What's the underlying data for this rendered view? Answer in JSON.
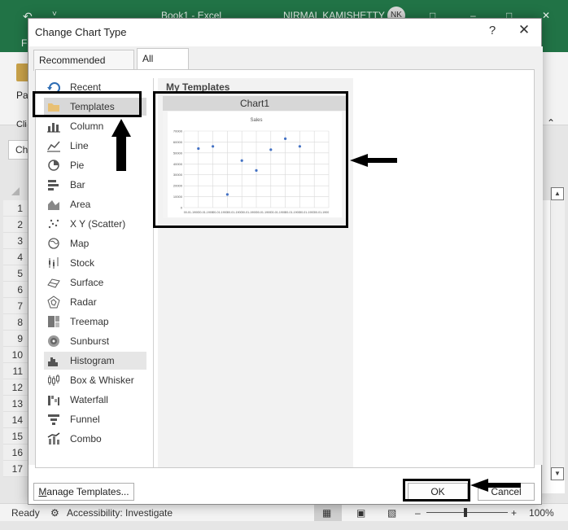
{
  "excel": {
    "title_left": "Book1 - Excel",
    "user_name": "NIRMAL KAMISHETTY",
    "user_initials": "NK",
    "ribbon_letters": [
      "F",
      "Pa",
      "Cli",
      "Ch"
    ],
    "rows": [
      "1",
      "2",
      "3",
      "4",
      "5",
      "6",
      "7",
      "8",
      "9",
      "10",
      "11",
      "12",
      "13",
      "14",
      "15",
      "16",
      "17"
    ],
    "status_ready": "Ready",
    "status_accessibility": "Accessibility: Investigate",
    "zoom_minus": "–",
    "zoom_plus": "+",
    "zoom_level": "100%"
  },
  "dialog": {
    "title": "Change Chart Type",
    "help": "?",
    "close": "✕",
    "tabs": [
      {
        "label": "Recommended Charts"
      },
      {
        "label": "All Charts"
      }
    ],
    "categories": [
      {
        "label": "Recent",
        "icon": "recent-icon"
      },
      {
        "label": "Templates",
        "icon": "folder-icon"
      },
      {
        "label": "Column",
        "icon": "column-chart-icon"
      },
      {
        "label": "Line",
        "icon": "line-chart-icon"
      },
      {
        "label": "Pie",
        "icon": "pie-chart-icon"
      },
      {
        "label": "Bar",
        "icon": "bar-chart-icon"
      },
      {
        "label": "Area",
        "icon": "area-chart-icon"
      },
      {
        "label": "X Y (Scatter)",
        "icon": "scatter-chart-icon"
      },
      {
        "label": "Map",
        "icon": "map-chart-icon"
      },
      {
        "label": "Stock",
        "icon": "stock-chart-icon"
      },
      {
        "label": "Surface",
        "icon": "surface-chart-icon"
      },
      {
        "label": "Radar",
        "icon": "radar-chart-icon"
      },
      {
        "label": "Treemap",
        "icon": "treemap-chart-icon"
      },
      {
        "label": "Sunburst",
        "icon": "sunburst-chart-icon"
      },
      {
        "label": "Histogram",
        "icon": "histogram-chart-icon"
      },
      {
        "label": "Box & Whisker",
        "icon": "box-whisker-chart-icon"
      },
      {
        "label": "Waterfall",
        "icon": "waterfall-chart-icon"
      },
      {
        "label": "Funnel",
        "icon": "funnel-chart-icon"
      },
      {
        "label": "Combo",
        "icon": "combo-chart-icon"
      }
    ],
    "templates_heading": "My Templates",
    "template_name": "Chart1",
    "manage_templates_label": "Manage Templates...",
    "manage_templates_mnemonic": "M",
    "manage_templates_rest": "anage Templates...",
    "ok_label": "OK",
    "cancel_label": "Cancel",
    "accent_color": "#217346",
    "selected_bg": "#d8d8d8"
  },
  "chart_data": {
    "type": "scatter",
    "title": "Sales",
    "x": [
      "00-01-1900",
      "00-01-1900",
      "00-01-1900",
      "00-01-1900",
      "00-01-1900",
      "00-01-1900",
      "00-01-1900",
      "00-01-1900",
      "00-01-1900",
      "00-01-1900"
    ],
    "values": [
      54000,
      56000,
      12000,
      43000,
      34000,
      53000,
      63000,
      56000
    ],
    "ylim": [
      0,
      70000
    ],
    "yticks": [
      0,
      10000,
      20000,
      30000,
      40000,
      50000,
      60000,
      70000
    ],
    "grid": true,
    "series_color": "#4472c4"
  }
}
